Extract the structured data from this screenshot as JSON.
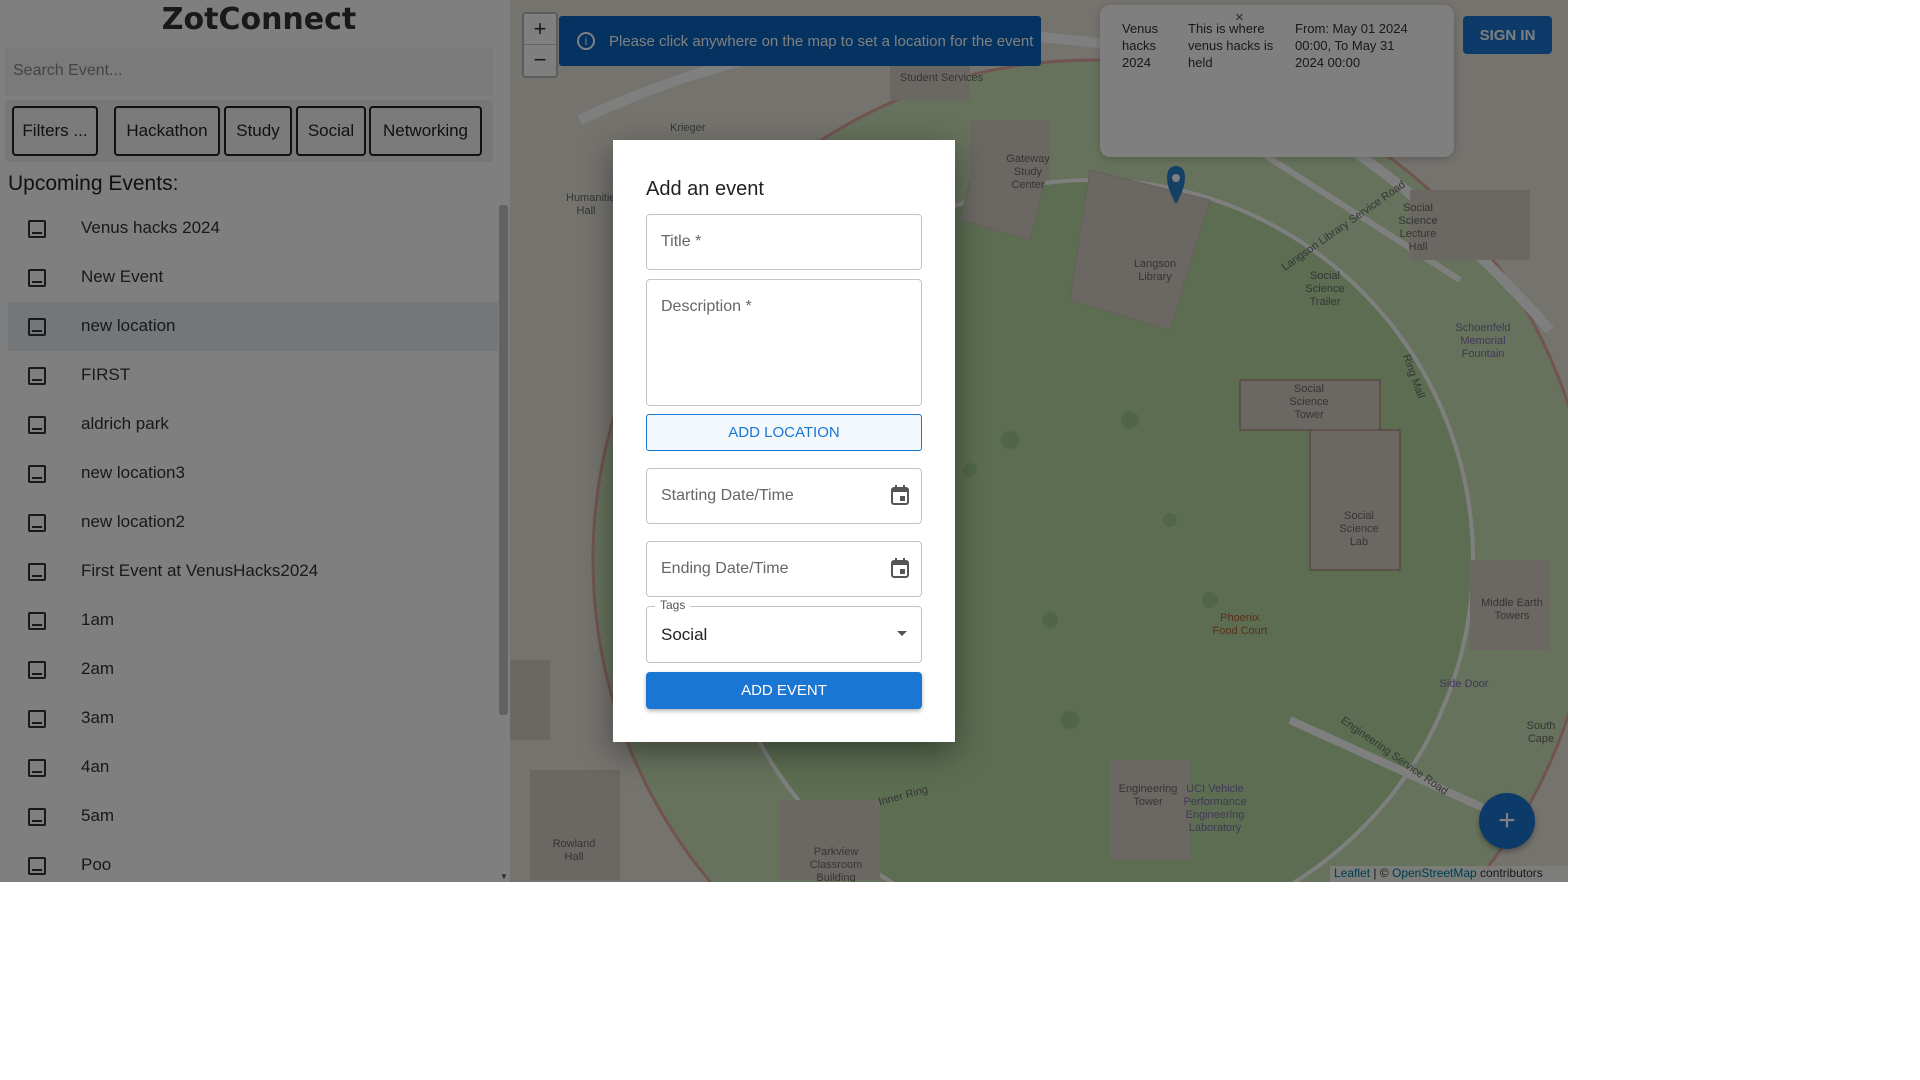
{
  "app": {
    "title": "ZotConnect"
  },
  "search": {
    "placeholder": "Search Event..."
  },
  "filters": {
    "chips": [
      "Filters ...",
      "Hackathon",
      "Study",
      "Social",
      "Networking"
    ]
  },
  "events": {
    "heading": "Upcoming Events:",
    "items": [
      "Venus hacks 2024",
      "New Event",
      "new location",
      "FIRST",
      "aldrich park",
      "new location3",
      "new location2",
      "First Event at VenusHacks2024",
      "1am",
      "2am",
      "3am",
      "4an",
      "5am",
      "Poo"
    ],
    "active_index": 2
  },
  "map": {
    "zoom_in": "+",
    "zoom_out": "−",
    "info_banner": "Please click anywhere on the map to set a location for the event",
    "popup": {
      "name": "Venus hacks 2024",
      "description": "This is where venus hacks is held",
      "dates": "From: May 01 2024 00:00, To May 31 2024 00:00",
      "close": "×"
    },
    "labels": [
      "Student Services",
      "Gateway Study Center",
      "Langson Library",
      "Social Science Trailer",
      "Social Science Lecture Hall",
      "Social Science Tower",
      "Social Science Lab",
      "Middle Earth Towers",
      "Phoenix Food Court",
      "Engineering Tower",
      "UCI Vehicle Performance Engineering Laboratory",
      "Rowland Hall",
      "Parkview Classroom Building",
      "Humanities Hall",
      "Schoenfeld Memorial Fountain",
      "Side Door",
      "South Cape",
      "Krieger",
      "Inner Ring",
      "Ring Mall",
      "Engineering Service Road",
      "Langson Library Service Road"
    ],
    "attribution": {
      "leaflet": "Leaflet",
      "separator": " | © ",
      "osm": "OpenStreetMap",
      "suffix": " contributors"
    }
  },
  "header": {
    "signin": "SIGN IN"
  },
  "fab": {
    "label": "+"
  },
  "modal": {
    "title": "Add an event",
    "title_field": "Title *",
    "description_field": "Description *",
    "add_location": "ADD LOCATION",
    "start": "Starting Date/Time",
    "end": "Ending Date/Time",
    "tags_label": "Tags",
    "tags_value": "Social",
    "submit": "ADD EVENT"
  },
  "colors": {
    "primary": "#1976d2",
    "banner": "#0a66c2",
    "overlay": "rgba(0,0,0,0.5)"
  }
}
